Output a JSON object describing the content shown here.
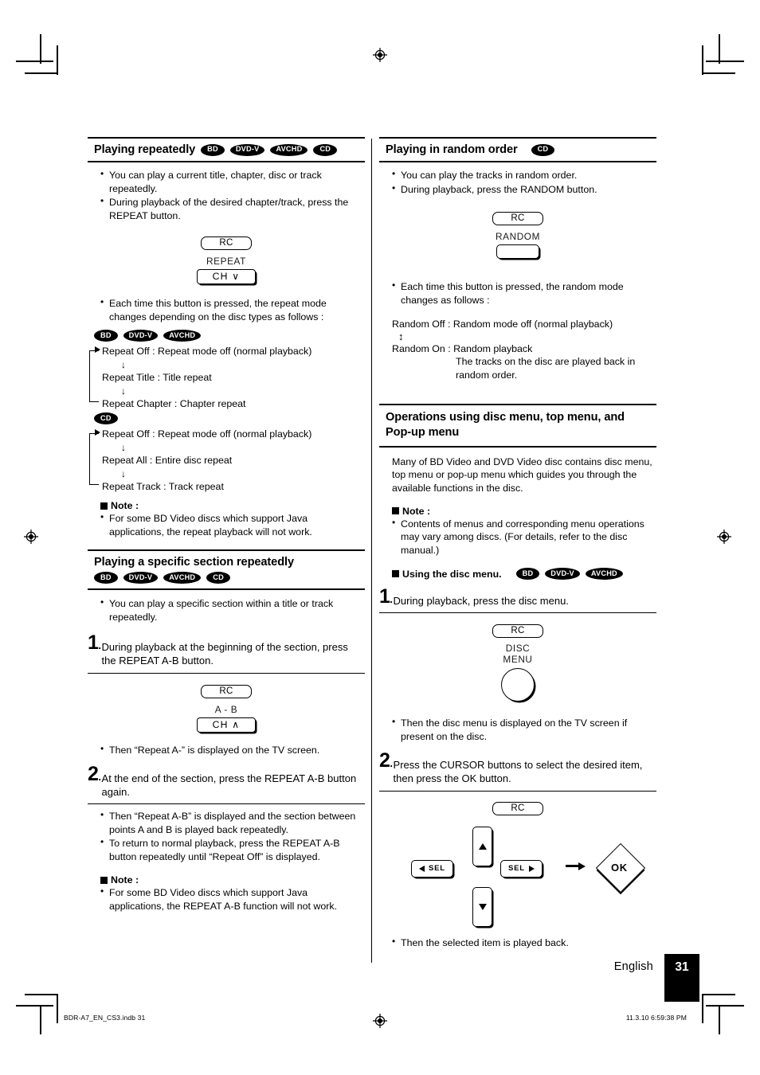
{
  "document": {
    "language_label": "English",
    "page_number": "31",
    "file_note": "BDR-A7_EN_CS3.indb   31",
    "date_note": "11.3.10   6:59:38 PM"
  },
  "left_column": {
    "section1": {
      "heading": "Playing repeatedly",
      "badges": [
        "BD",
        "DVD-V",
        "AVCHD",
        "CD"
      ],
      "bullets": [
        "You can play a current title, chapter, disc or track repeatedly.",
        "During playback of the desired chapter/track, press the REPEAT button."
      ],
      "remote": {
        "rc_label": "RC",
        "key_label": "REPEAT",
        "key_button": "CH ∨"
      },
      "after_bullets": [
        "Each time this button is pressed, the repeat mode changes depending on the disc types as follows :"
      ],
      "flow_bd": {
        "badges": [
          "BD",
          "DVD-V",
          "AVCHD"
        ],
        "items": [
          "Repeat Off : Repeat mode off (normal playback)",
          "Repeat Title : Title repeat",
          "Repeat Chapter : Chapter repeat"
        ]
      },
      "flow_cd": {
        "badges": [
          "CD"
        ],
        "items": [
          "Repeat Off : Repeat mode off (normal playback)",
          "Repeat All : Entire disc repeat",
          "Repeat Track : Track repeat"
        ]
      },
      "note": {
        "title": "Note :",
        "bullets": [
          "For some BD Video discs which support Java applications, the repeat playback will not work."
        ]
      }
    },
    "section2": {
      "heading": "Playing a specific section repeatedly",
      "badges": [
        "BD",
        "DVD-V",
        "AVCHD",
        "CD"
      ],
      "bullets": [
        "You can play a specific section within a title or track repeatedly."
      ],
      "step1": {
        "number": "1",
        "text": "During playback at the beginning of the section, press the REPEAT A-B button."
      },
      "remote": {
        "rc_label": "RC",
        "key_label": "A - B",
        "key_button": "CH ∧"
      },
      "after_step1_bullets": [
        "Then “Repeat A-” is displayed on the TV screen."
      ],
      "step2": {
        "number": "2",
        "text": "At the end of the section, press the REPEAT A-B button again."
      },
      "after_step2_bullets": [
        "Then “Repeat A-B” is displayed and the section between points A and B is played back repeatedly.",
        "To return to normal playback, press the REPEAT A-B button repeatedly until “Repeat Off” is displayed."
      ],
      "note": {
        "title": "Note :",
        "bullets": [
          "For some BD Video discs which support Java applications, the REPEAT A-B function will not work."
        ]
      }
    }
  },
  "right_column": {
    "section1": {
      "heading": "Playing in random order",
      "badges": [
        "CD"
      ],
      "bullets": [
        "You can play the tracks in random order.",
        "During playback, press the RANDOM button."
      ],
      "remote": {
        "rc_label": "RC",
        "key_label": "RANDOM",
        "key_button": ""
      },
      "after_bullets": [
        "Each time this button is pressed, the random mode changes as follows :"
      ],
      "random_flow": {
        "line1": "Random Off : Random mode off (normal playback)",
        "line2": "Random On : Random playback",
        "sub": "The tracks on the disc are played back in random order."
      }
    },
    "section2": {
      "heading_line1": "Operations using disc menu, top menu, and",
      "heading_line2": "Pop-up menu",
      "intro": "Many of BD Video and DVD Video disc contains disc menu, top menu or pop-up menu which guides you through the available functions in the disc.",
      "note": {
        "title": "Note :",
        "bullets": [
          "Contents of menus and corresponding menu operations may vary among discs. (For details, refer to the disc manual.)"
        ]
      },
      "subhead": {
        "title": "Using the disc menu.",
        "badges": [
          "BD",
          "DVD-V",
          "AVCHD"
        ]
      },
      "step1": {
        "number": "1",
        "text": "During playback, press the disc menu."
      },
      "remote1": {
        "rc_label": "RC",
        "key_label_line1": "DISC",
        "key_label_line2": "MENU"
      },
      "after_step1_bullets": [
        "Then the disc menu is displayed on the TV screen if present on the disc."
      ],
      "step2": {
        "number": "2",
        "text": "Press the CURSOR buttons to select the desired item, then press the OK button."
      },
      "remote2": {
        "rc_label": "RC",
        "left_key": "SEL",
        "right_key": "SEL",
        "ok_key": "OK"
      },
      "after_step2_bullets": [
        "Then the selected item is played back."
      ]
    }
  }
}
